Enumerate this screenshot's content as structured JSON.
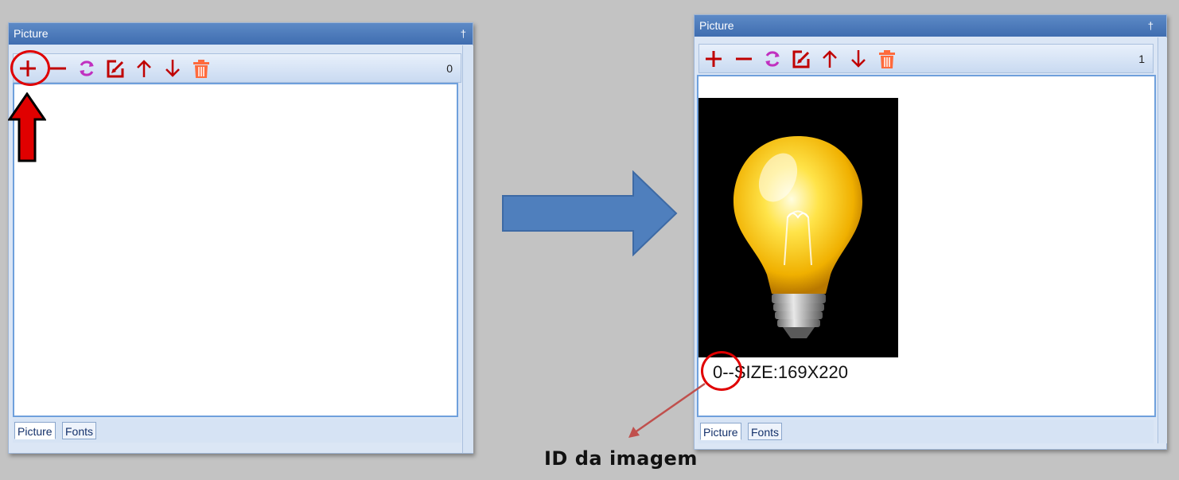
{
  "left_window": {
    "title": "Picture",
    "pin_glyph": "†",
    "count": "0",
    "tabs": [
      "Picture",
      "Fonts"
    ]
  },
  "right_window": {
    "title": "Picture",
    "pin_glyph": "†",
    "count": "1",
    "tabs": [
      "Picture",
      "Fonts"
    ],
    "image_caption": "0--SIZE:169X220"
  },
  "toolbar_icons": [
    "add-icon",
    "remove-icon",
    "refresh-icon",
    "edit-icon",
    "move-up-icon",
    "move-down-icon",
    "trash-icon"
  ],
  "colors": {
    "icon_dark_red": "#c00000",
    "icon_purple": "#c030c0",
    "icon_trash": "#ff6a3c",
    "annotation_red": "#e00000",
    "big_arrow": "#4f7fbd",
    "pointer_arrow": "#c0504d"
  },
  "annotation": {
    "label": "ID da imagem"
  }
}
